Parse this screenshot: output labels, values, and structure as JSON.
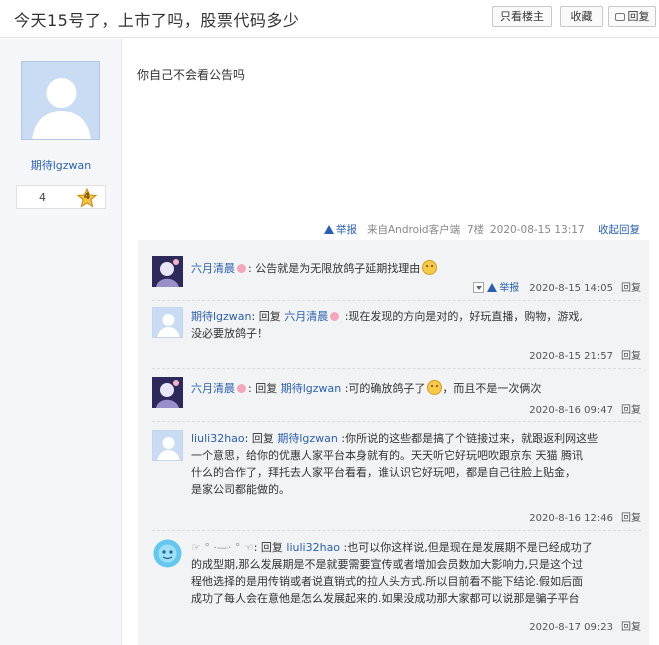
{
  "header": {
    "title": "今天15号了，上市了吗，股票代码多少",
    "only_author": "只看楼主",
    "favorite": "收藏",
    "reply": "回复"
  },
  "author": {
    "name": "期待lgzwan",
    "level_number": "4",
    "level_badge": "4"
  },
  "post": {
    "content": "你自己不会看公告吗",
    "report": "举报",
    "source": "来自Android客户端",
    "floor": "7楼",
    "datetime": "2020-08-15 13:17",
    "fold_reply": "收起回复"
  },
  "comments": [
    {
      "user": "六月清晨",
      "segments": [
        ": 公告就是为无限放鸽子延期找理由"
      ],
      "report": "举报",
      "datetime": "2020-8-15 14:05",
      "reply": "回复"
    },
    {
      "user": "期待lgzwan",
      "reply_word": ": 回复 ",
      "target": "六月清晨",
      "text_line1": " :现在发现的方向是对的，好玩直播，购物，游戏,",
      "text_line2": "没必要放鸽子！",
      "datetime": "2020-8-15 21:57",
      "reply": "回复"
    },
    {
      "user": "六月清晨",
      "reply_word": ": 回复 ",
      "target": "期待lgzwan",
      "text_a": " :可的确放鸽子了",
      "text_b": "，而且不是一次俩次",
      "datetime": "2020-8-16 09:47",
      "reply": "回复"
    },
    {
      "user": "liuli32hao",
      "reply_word": ": 回复 ",
      "target": "期待lgzwan",
      "text_line1": " :你所说的这些都是搞了个链接过来，就跟返利网这些",
      "text_line2": "一个意思，给你的优惠人家平台本身就有的。天天听它好玩吧吹跟京东 天猫 腾讯",
      "text_line3": "什么的合作了，拜托去人家平台看看，谁认识它好玩吧，都是自己往脸上贴金，",
      "text_line4": "是家公司都能做的。",
      "datetime": "2020-8-16 12:46",
      "reply": "回复"
    },
    {
      "user": "☞ ° ‧—‧ ° ☜",
      "reply_word": ": 回复 ",
      "target": "liuli32hao",
      "text_line1": " :也可以你这样说,但是现在是发展期不是已经成功了",
      "text_line2": "的成型期,那么发展期是不是就要需要宣传或者增加会员数加大影响力,只是这个过",
      "text_line3": "程他选择的是用传销或者说直销式的拉人头方式.所以目前看不能下结论.假如后面",
      "text_line4": "成功了每人会在意他是怎么发展起来的.如果没成功那大家都可以说那是骗子平台",
      "datetime": "2020-8-17 09:23",
      "reply": "回复"
    }
  ]
}
